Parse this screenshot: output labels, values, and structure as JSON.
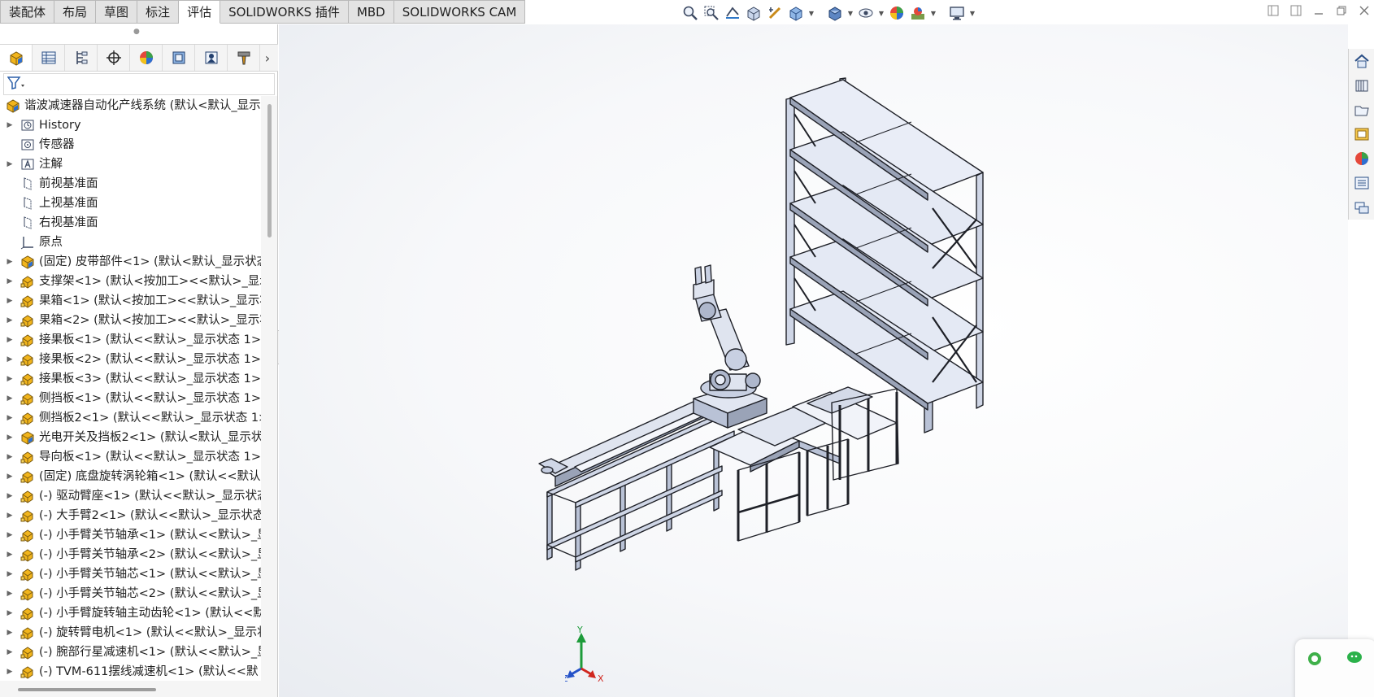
{
  "command_manager": {
    "tabs": [
      {
        "label": "装配体",
        "active": false
      },
      {
        "label": "布局",
        "active": false
      },
      {
        "label": "草图",
        "active": false
      },
      {
        "label": "标注",
        "active": false
      },
      {
        "label": "评估",
        "active": true
      },
      {
        "label": "SOLIDWORKS 插件",
        "active": false
      },
      {
        "label": "MBD",
        "active": false
      },
      {
        "label": "SOLIDWORKS CAM",
        "active": false
      }
    ]
  },
  "heads_up_toolbar": {
    "icons": [
      "zoom-to-fit-icon",
      "zoom-to-area-icon",
      "previous-view-icon",
      "section-view-icon",
      "dynamic-annotation-icon",
      "view-orientation-icon",
      "display-style-icon",
      "hide-show-items-icon",
      "edit-appearance-icon",
      "apply-scene-icon",
      "view-settings-icon"
    ]
  },
  "feature_manager": {
    "tab_icons": [
      "feature-manager-tree-icon",
      "property-manager-icon",
      "configuration-manager-icon",
      "dimxpert-manager-icon",
      "display-manager-icon",
      "cam-feature-tree-icon",
      "cam-operation-tree-icon",
      "cam-tool-tree-icon"
    ],
    "tree": [
      {
        "label": "谐波减速器自动化产线系统 (默认<默认_显示",
        "icon": "assembly-icon",
        "root": true,
        "expander": false
      },
      {
        "label": "History",
        "icon": "history-folder-icon",
        "expander": true
      },
      {
        "label": "传感器",
        "icon": "sensor-folder-icon",
        "expander": false
      },
      {
        "label": "注解",
        "icon": "annotation-folder-icon",
        "expander": true
      },
      {
        "label": "前视基准面",
        "icon": "plane-icon",
        "expander": false
      },
      {
        "label": "上视基准面",
        "icon": "plane-icon",
        "expander": false
      },
      {
        "label": "右视基准面",
        "icon": "plane-icon",
        "expander": false
      },
      {
        "label": "原点",
        "icon": "origin-icon",
        "expander": false
      },
      {
        "label": "(固定) 皮带部件<1> (默认<默认_显示状态",
        "icon": "subassembly-icon",
        "expander": true
      },
      {
        "label": "支撑架<1> (默认<按加工><<默认>_显示",
        "icon": "part-icon",
        "expander": true
      },
      {
        "label": "果箱<1> (默认<按加工><<默认>_显示状",
        "icon": "part-icon",
        "expander": true
      },
      {
        "label": "果箱<2> (默认<按加工><<默认>_显示状",
        "icon": "part-icon",
        "expander": true
      },
      {
        "label": "接果板<1> (默认<<默认>_显示状态 1>)",
        "icon": "part-icon",
        "expander": true
      },
      {
        "label": "接果板<2> (默认<<默认>_显示状态 1>)",
        "icon": "part-icon",
        "expander": true
      },
      {
        "label": "接果板<3> (默认<<默认>_显示状态 1>)",
        "icon": "part-icon",
        "expander": true
      },
      {
        "label": "侧挡板<1> (默认<<默认>_显示状态 1>)",
        "icon": "part-icon",
        "expander": true
      },
      {
        "label": "侧挡板2<1> (默认<<默认>_显示状态 1>",
        "icon": "part-icon",
        "expander": true
      },
      {
        "label": "光电开关及挡板2<1> (默认<默认_显示状",
        "icon": "subassembly-icon",
        "expander": true
      },
      {
        "label": "导向板<1> (默认<<默认>_显示状态 1>)",
        "icon": "part-icon",
        "expander": true
      },
      {
        "label": "(固定) 底盘旋转涡轮箱<1> (默认<<默认",
        "icon": "part-icon",
        "expander": true
      },
      {
        "label": "(-) 驱动臂座<1> (默认<<默认>_显示状态",
        "icon": "part-icon",
        "expander": true
      },
      {
        "label": "(-) 大手臂2<1> (默认<<默认>_显示状态",
        "icon": "part-icon",
        "expander": true
      },
      {
        "label": "(-) 小手臂关节轴承<1> (默认<<默认>_显",
        "icon": "part-icon",
        "expander": true
      },
      {
        "label": "(-) 小手臂关节轴承<2> (默认<<默认>_显",
        "icon": "part-icon",
        "expander": true
      },
      {
        "label": "(-) 小手臂关节轴芯<1> (默认<<默认>_显",
        "icon": "part-icon",
        "expander": true
      },
      {
        "label": "(-) 小手臂关节轴芯<2> (默认<<默认>_显",
        "icon": "part-icon",
        "expander": true
      },
      {
        "label": "(-) 小手臂旋转轴主动齿轮<1> (默认<<默",
        "icon": "part-icon",
        "expander": true
      },
      {
        "label": "(-) 旋转臂电机<1> (默认<<默认>_显示状",
        "icon": "part-icon",
        "expander": true
      },
      {
        "label": "(-) 腕部行星减速机<1> (默认<<默认>_显",
        "icon": "part-icon",
        "expander": true
      },
      {
        "label": "(-) TVM-611摆线减速机<1> (默认<<默",
        "icon": "part-icon",
        "expander": true
      }
    ]
  },
  "triad": {
    "x_label": "X",
    "y_label": "Y",
    "z_label": "Z"
  },
  "task_pane": {
    "icons": [
      "solidworks-resources-icon",
      "design-library-icon",
      "file-explorer-icon",
      "view-palette-icon",
      "appearances-scenes-icon",
      "custom-properties-icon",
      "forum-icon"
    ]
  },
  "colors": {
    "tab_active": "#ffffff",
    "tab_inactive": "#e3e3e3",
    "part_icon": "#f2b51c",
    "model_face": "#e8ecf6",
    "model_edge": "#1c1e24"
  }
}
